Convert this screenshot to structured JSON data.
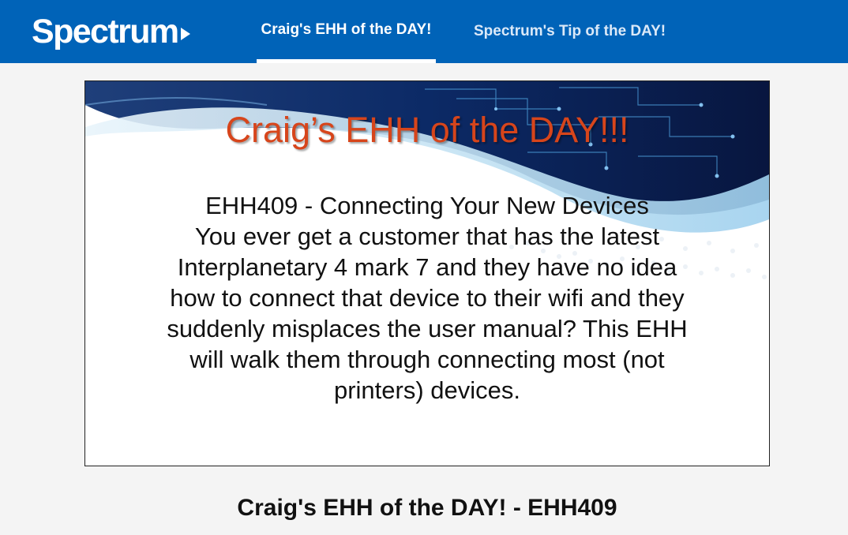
{
  "header": {
    "brand": "Spectrum",
    "tabs": [
      {
        "label": "Craig's EHH of the DAY!",
        "active": true
      },
      {
        "label": "Spectrum's Tip of the DAY!",
        "active": false
      }
    ]
  },
  "slide": {
    "title": "Craig’s EHH of the DAY!!!",
    "lines": [
      "EHH409 - Connecting Your New Devices",
      "You ever get a customer that has the latest",
      "Interplanetary 4 mark 7 and they have no idea",
      "how to connect that device to their wifi and they",
      "suddenly misplaces the user manual? This EHH",
      "will walk them through connecting most (not",
      "printers) devices."
    ]
  },
  "caption": "Craig's EHH of the DAY! - EHH409",
  "colors": {
    "header_bg": "#0063b8",
    "title_orange": "#d7451b",
    "banner_dark": "#0b1b4a"
  },
  "icons": {
    "logo_arrow": "play-triangle-icon"
  }
}
